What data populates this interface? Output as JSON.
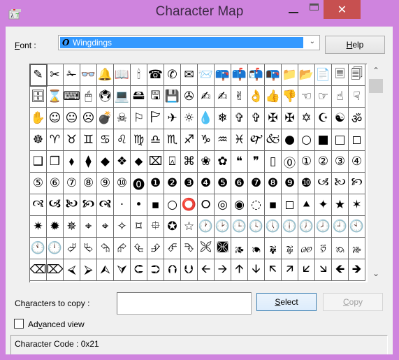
{
  "window": {
    "title": "Character Map",
    "app_icon": "charmap-app-icon",
    "controls": {
      "minimize": "minimize",
      "maximize": "maximize",
      "close": "✕"
    }
  },
  "font": {
    "label_prefix": "",
    "label_underlined": "F",
    "label_rest": "ont :",
    "selected": "Wingdings",
    "selected_icon_glyph": "O",
    "dropdown_icon": "⌄"
  },
  "help_button": {
    "underlined": "H",
    "rest": "elp"
  },
  "grid": {
    "columns": 20,
    "rows": 10,
    "selected_index": 0,
    "cells": [
      "✎",
      "✂",
      "✁",
      "👓",
      "🔔",
      "📖",
      "🕯",
      "☎",
      "✆",
      "✉",
      "📨",
      "📪",
      "📫",
      "📬",
      "📭",
      "📁",
      "📂",
      "📄",
      "🗏",
      "🗐",
      "🗄",
      "⌛",
      "⌨",
      "🖱",
      "🖲",
      "💻",
      "🖴",
      "🖫",
      "💾",
      "✇",
      "✍",
      "✍",
      "✌",
      "👌",
      "👍",
      "👎",
      "☜",
      "☞",
      "☝",
      "☟",
      "✋",
      "☺",
      "😐",
      "☹",
      "💣",
      "☠",
      "⚐",
      "🏱",
      "✈",
      "☼",
      "💧",
      "❄",
      "✞",
      "✞",
      "✠",
      "✠",
      "✡",
      "☪",
      "☯",
      "ॐ",
      "☸",
      "♈",
      "♉",
      "♊",
      "♋",
      "♌",
      "♍",
      "♎",
      "♏",
      "♐",
      "♑",
      "♒",
      "♓",
      "🙰",
      "🙵",
      "●",
      "○",
      "■",
      "□",
      "◻",
      "❑",
      "❒",
      "⬧",
      "⧫",
      "◆",
      "❖",
      "⬥",
      "⌧",
      "⍓",
      "⌘",
      "❀",
      "✿",
      "❝",
      "❞",
      "▯",
      "⓪",
      "①",
      "②",
      "③",
      "④",
      "⑤",
      "⑥",
      "⑦",
      "⑧",
      "⑨",
      "⑩",
      "⓿",
      "❶",
      "❷",
      "❸",
      "❹",
      "❺",
      "❻",
      "❼",
      "❽",
      "❾",
      "❿",
      "🙢",
      "🙠",
      "🙡",
      "🙣",
      "🙦",
      "🙤",
      "🙥",
      "🙧",
      "·",
      "•",
      "▪",
      "○",
      "⭕",
      "⭘",
      "◎",
      "◉",
      "◌",
      "▪",
      "◻",
      "⯅",
      "✦",
      "★",
      "✶",
      "✷",
      "✹",
      "✵",
      "⌖",
      "⌖",
      "✧",
      "⌑",
      "⯐",
      "✪",
      "☆",
      "🕐",
      "🕑",
      "🕒",
      "🕓",
      "🕔",
      "🕕",
      "🕖",
      "🕗",
      "🕘",
      "🕙",
      "🕚",
      "🕛",
      "⮰",
      "⮱",
      "⮲",
      "⮳",
      "⮴",
      "⮵",
      "⮶",
      "⮷",
      "🙪",
      "🙫",
      "🙕",
      "🙔",
      "🙗",
      "🙖",
      "🙐",
      "🙑",
      "🙒",
      "🙓",
      "⌫",
      "⌦",
      "⮘",
      "⮚",
      "⮙",
      "⮛",
      "⮈",
      "⮊",
      "⮉",
      "⮋",
      "🡨",
      "🡪",
      "🡩",
      "🡫",
      "🡬",
      "🡭",
      "🡯",
      "🡮",
      "🡸",
      "🡺"
    ]
  },
  "scrollbar": {
    "up_icon": "⌃",
    "down_icon": "⌄"
  },
  "copy": {
    "label_prefix": "Ch",
    "label_underlined": "a",
    "label_rest": "racters to copy :",
    "input_value": "",
    "select_button": {
      "underlined": "S",
      "rest": "elect"
    },
    "copy_button": {
      "underlined": "C",
      "rest": "opy"
    }
  },
  "advanced": {
    "checked": false,
    "label_prefix": "Ad",
    "label_underlined": "v",
    "label_rest": "anced view"
  },
  "status": {
    "text": "Character Code : 0x21"
  },
  "colors": {
    "frame": "#cf84de",
    "close": "#c75050",
    "selection": "#3399ff",
    "client": "#f0f0f0"
  }
}
